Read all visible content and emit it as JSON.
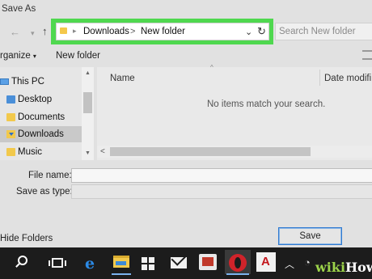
{
  "window": {
    "title": "Save As"
  },
  "address_bar": {
    "crumbs": [
      "Downloads",
      "New folder"
    ],
    "separator": ">",
    "highlight_color": "#4fd84f"
  },
  "search": {
    "placeholder": "Search New folder"
  },
  "toolbar": {
    "organize_label": "rganize",
    "organize_caret": "▾",
    "new_folder_label": "New folder"
  },
  "nav_pane": {
    "items": [
      {
        "label": "This PC",
        "icon": "computer-icon"
      },
      {
        "label": "Desktop",
        "icon": "folder-icon"
      },
      {
        "label": "Documents",
        "icon": "folder-icon"
      },
      {
        "label": "Downloads",
        "icon": "download-folder-icon",
        "selected": true
      },
      {
        "label": "Music",
        "icon": "music-folder-icon"
      }
    ]
  },
  "file_list": {
    "columns": [
      "Name",
      "Date modifi"
    ],
    "empty_message": "No items match your search."
  },
  "fields": {
    "file_name_label": "File name:",
    "file_name_value": "",
    "save_as_type_label": "Save as type:",
    "save_as_type_value": ""
  },
  "footer": {
    "hide_folders_label": "Hide Folders",
    "save_label": "Save"
  },
  "taskbar": {
    "icons": [
      "search-icon",
      "task-view-icon",
      "edge-icon",
      "file-explorer-icon",
      "store-icon",
      "mail-icon",
      "reader-icon",
      "opera-icon",
      "acrobat-icon",
      "chevron-up-icon",
      "wifi-icon"
    ],
    "watermark_a": "wiki",
    "watermark_b": "How"
  },
  "colors": {
    "accent_blue": "#2f7ad0",
    "taskbar": "#1c1c1c"
  }
}
